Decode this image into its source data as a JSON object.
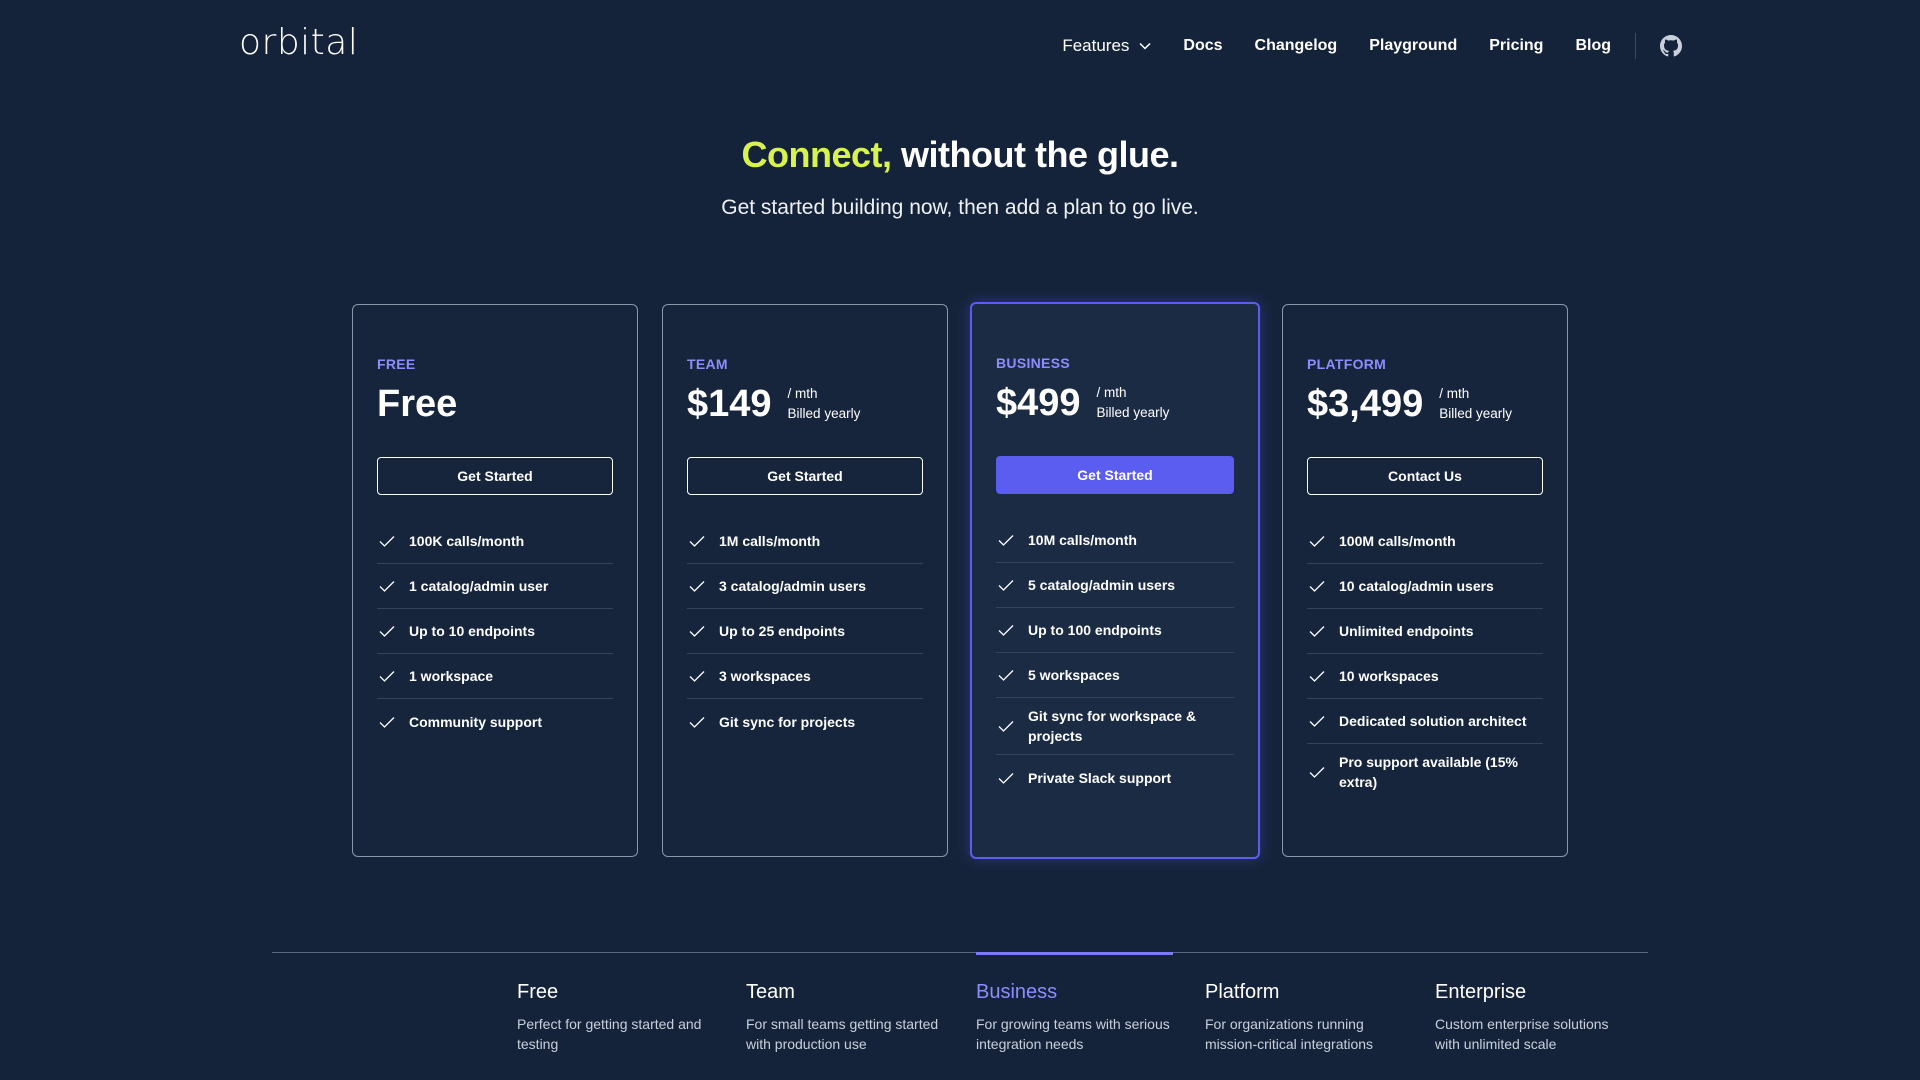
{
  "header": {
    "logo": "orbital",
    "nav": [
      {
        "label": "Features"
      },
      {
        "label": "Docs"
      },
      {
        "label": "Changelog"
      },
      {
        "label": "Playground"
      },
      {
        "label": "Pricing"
      },
      {
        "label": "Blog"
      }
    ],
    "github_icon": "github-icon"
  },
  "hero": {
    "accent": "Connect,",
    "title_rest": " without the glue.",
    "subtitle": "Get started building now, then add a plan to go live."
  },
  "plans": [
    {
      "tier": "FREE",
      "price": "Free",
      "cta": "Get Started",
      "features": [
        "100K calls/month",
        "1 catalog/admin user",
        "Up to 10 endpoints",
        "1 workspace",
        "Community support"
      ]
    },
    {
      "tier": "TEAM",
      "price": "$149",
      "period": "/ mth",
      "billing": "Billed yearly",
      "cta": "Get Started",
      "features": [
        "1M calls/month",
        "3 catalog/admin users",
        "Up to 25 endpoints",
        "3 workspaces",
        "Git sync for projects"
      ]
    },
    {
      "tier": "BUSINESS",
      "price": "$499",
      "period": "/ mth",
      "billing": "Billed yearly",
      "cta": "Get Started",
      "features": [
        "10M calls/month",
        "5 catalog/admin users",
        "Up to 100 endpoints",
        "5 workspaces",
        "Git sync for workspace & projects",
        "Private Slack support"
      ]
    },
    {
      "tier": "PLATFORM",
      "price": "$3,499",
      "period": "/ mth",
      "billing": "Billed yearly",
      "cta": "Contact Us",
      "features": [
        "100M calls/month",
        "10 catalog/admin users",
        "Unlimited endpoints",
        "10 workspaces",
        "Dedicated solution architect",
        "Pro support available (15% extra)"
      ]
    }
  ],
  "tabs": [
    {
      "title": "Free",
      "desc": "Perfect for getting started and testing"
    },
    {
      "title": "Team",
      "desc": "For small teams getting started with production use"
    },
    {
      "title": "Business",
      "desc": "For growing teams with serious integration needs"
    },
    {
      "title": "Platform",
      "desc": "For organizations running mission-critical integrations"
    },
    {
      "title": "Enterprise",
      "desc": "Custom enterprise solutions with unlimited scale"
    }
  ],
  "colors": {
    "background": "#15233a",
    "accent_lime": "#d8f34d",
    "primary": "#5b5cf0",
    "tier_label": "#8f8cff"
  }
}
